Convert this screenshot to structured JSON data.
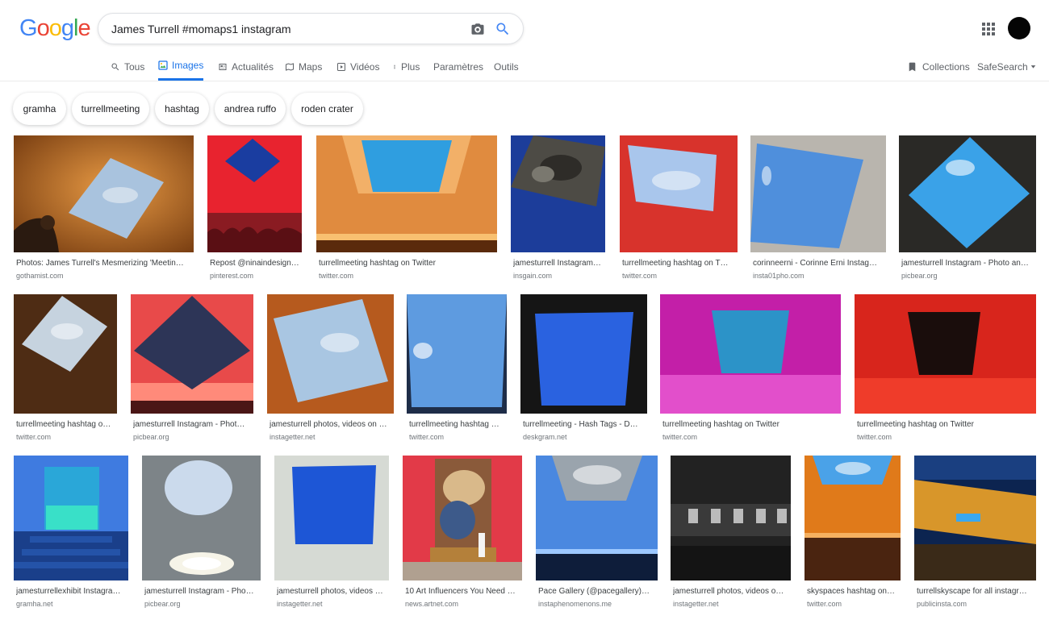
{
  "search": {
    "query": "James Turrell #momaps1 instagram"
  },
  "colors": {
    "accent": "#1a73e8",
    "g_blue": "#4285f4",
    "g_red": "#ea4335",
    "g_yellow": "#fbbc05",
    "g_green": "#34a853"
  },
  "tabs": [
    {
      "label": "Tous",
      "icon": "search-icon"
    },
    {
      "label": "Images",
      "icon": "image-icon"
    },
    {
      "label": "Actualités",
      "icon": "news-icon"
    },
    {
      "label": "Maps",
      "icon": "map-icon"
    },
    {
      "label": "Vidéos",
      "icon": "video-icon"
    },
    {
      "label": "Plus",
      "icon": "more-icon"
    },
    {
      "label": "Paramètres"
    },
    {
      "label": "Outils"
    }
  ],
  "right_tools": {
    "collections": "Collections",
    "safesearch": "SafeSearch"
  },
  "chips": [
    "gramha",
    "turrellmeeting",
    "hashtag",
    "andrea ruffo",
    "roden crater"
  ],
  "results": [
    {
      "caption": "Photos: James Turrell's Mesmerizing 'Meetin…",
      "source": "gothamist.com"
    },
    {
      "caption": "Repost @ninaindesign…",
      "source": "pinterest.com"
    },
    {
      "caption": "turrellmeeting hashtag on Twitter",
      "source": "twitter.com"
    },
    {
      "caption": "jamesturrell Instagram…",
      "source": "insgain.com"
    },
    {
      "caption": "turrellmeeting hashtag on T…",
      "source": "twitter.com"
    },
    {
      "caption": "corinneerni - Corinne Erni Instag…",
      "source": "insta01pho.com"
    },
    {
      "caption": "jamesturrell Instagram - Photo an…",
      "source": "picbear.org"
    },
    {
      "caption": "turrellmeeting hashtag o…",
      "source": "twitter.com"
    },
    {
      "caption": "jamesturrell Instagram - Phot…",
      "source": "picbear.org"
    },
    {
      "caption": "jamesturrell photos, videos on …",
      "source": "instagetter.net"
    },
    {
      "caption": "turrellmeeting hashtag …",
      "source": "twitter.com"
    },
    {
      "caption": "turrellmeeting - Hash Tags - D…",
      "source": "deskgram.net"
    },
    {
      "caption": "turrellmeeting hashtag on Twitter",
      "source": "twitter.com"
    },
    {
      "caption": "turrellmeeting hashtag on Twitter",
      "source": "twitter.com"
    },
    {
      "caption": "jamesturrellexhibit Instagra…",
      "source": "gramha.net"
    },
    {
      "caption": "jamesturrell Instagram - Pho…",
      "source": "picbear.org"
    },
    {
      "caption": "jamesturrell photos, videos …",
      "source": "instagetter.net"
    },
    {
      "caption": "10 Art Influencers You Need …",
      "source": "news.artnet.com"
    },
    {
      "caption": "Pace Gallery (@pacegallery)…",
      "source": "instaphenomenons.me"
    },
    {
      "caption": "jamesturrell photos, videos o…",
      "source": "instagetter.net"
    },
    {
      "caption": "skyspaces hashtag on…",
      "source": "twitter.com"
    },
    {
      "caption": "turrellskyscape for all instagr…",
      "source": "publicinsta.com"
    }
  ]
}
